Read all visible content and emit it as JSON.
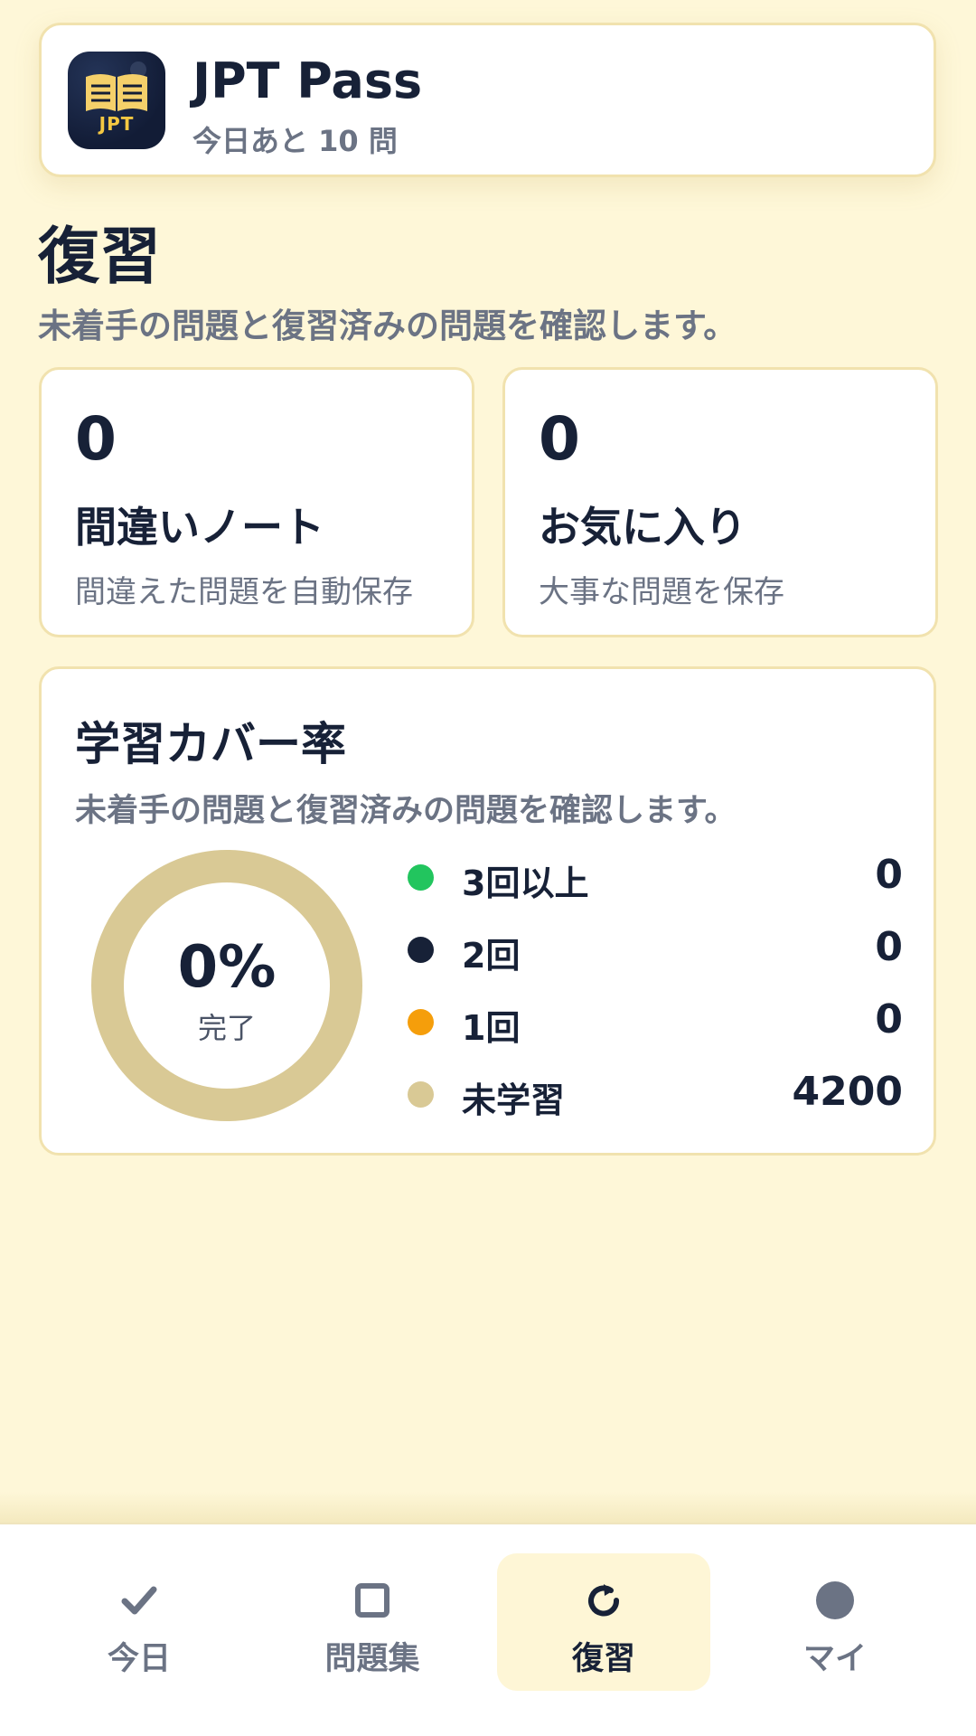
{
  "colors": {
    "page_background": "#fef7d8",
    "card_border": "#f1e2ae",
    "text_primary": "#172137",
    "text_secondary": "#6b7384",
    "accent_gold": "#d9c995",
    "green": "#22c55e",
    "navy": "#172137",
    "orange": "#f59e0b",
    "active_nav_bg": "#fef6d6"
  },
  "header": {
    "icon": "open-book-icon",
    "icon_text": "JPT",
    "title": "JPT Pass",
    "subtitle": "今日あと 10 問"
  },
  "page": {
    "title": "復習",
    "description": "未着手の問題と復習済みの問題を確認します。"
  },
  "stats": [
    {
      "value": "0",
      "label": "間違いノート",
      "description": "間違えた問題を自動保存"
    },
    {
      "value": "0",
      "label": "お気に入り",
      "description": "大事な問題を保存"
    }
  ],
  "coverage": {
    "title": "学習カバー率",
    "description": "未着手の問題と復習済みの問題を確認します。",
    "percent_text": "0%",
    "caption": "完了",
    "percent_complete": 0,
    "legend": [
      {
        "label": "3回以上",
        "value": "0",
        "color": "#22c55e"
      },
      {
        "label": "2回",
        "value": "0",
        "color": "#172137"
      },
      {
        "label": "1回",
        "value": "0",
        "color": "#f59e0b"
      },
      {
        "label": "未学習",
        "value": "4200",
        "color": "#d9c995"
      }
    ]
  },
  "nav": {
    "active_index": 2,
    "items": [
      {
        "label": "今日",
        "icon": "check-icon"
      },
      {
        "label": "問題集",
        "icon": "square-icon"
      },
      {
        "label": "復習",
        "icon": "refresh-icon"
      },
      {
        "label": "マイ",
        "icon": "circle-icon"
      }
    ]
  }
}
